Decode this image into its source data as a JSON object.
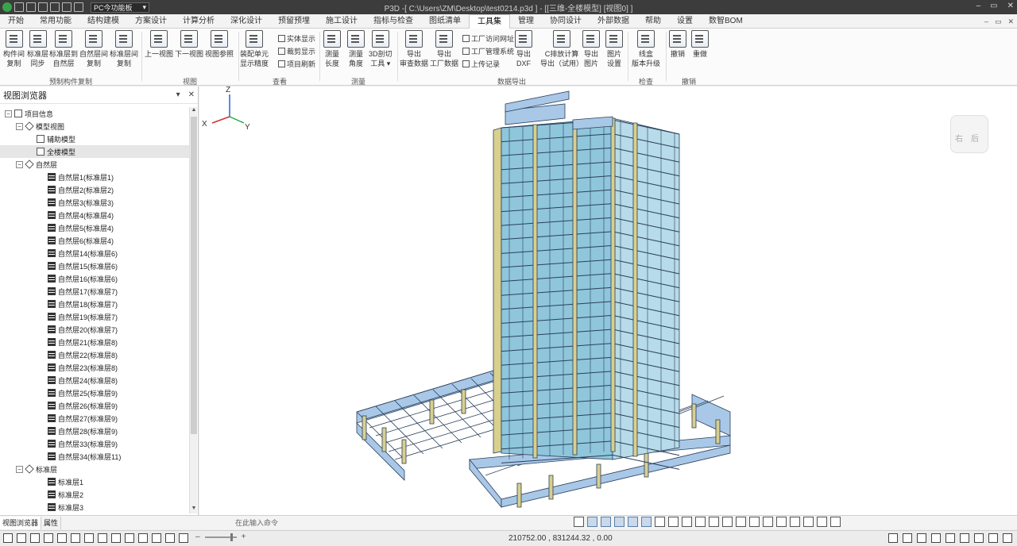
{
  "titlebar": {
    "mode": "PC今功能板",
    "title": "P3D -[ C:\\Users\\ZM\\Desktop\\test0214.p3d ] - [[三维-全楼模型]  [视图0] ]",
    "controls": [
      "–",
      "▭",
      "✕"
    ]
  },
  "menu": {
    "items": [
      "开始",
      "常用功能",
      "结构建模",
      "方案设计",
      "计算分析",
      "深化设计",
      "预留预埋",
      "施工设计",
      "指标与检查",
      "图纸清单",
      "工具集",
      "管理",
      "协同设计",
      "外部数据",
      "帮助",
      "设置",
      "数智BOM"
    ],
    "active_index": 10,
    "right_controls": [
      "–",
      "▭",
      "✕"
    ]
  },
  "ribbon": {
    "buttons": [
      {
        "line1": "构件间",
        "line2": "复制"
      },
      {
        "line1": "标准层",
        "line2": "同步"
      },
      {
        "line1": "标准层到",
        "line2": "自然层"
      },
      {
        "line1": "自然层间",
        "line2": "复制"
      },
      {
        "line1": "标准层间",
        "line2": "复制"
      },
      {
        "line1": "上一视图",
        "line2": ""
      },
      {
        "line1": "下一视图",
        "line2": ""
      },
      {
        "line1": "视图参照",
        "line2": ""
      },
      {
        "line1": "装配单元",
        "line2": "显示精度"
      },
      {
        "line1": "测量",
        "line2": "长度"
      },
      {
        "line1": "测量",
        "line2": "角度"
      },
      {
        "line1": "3D剖切",
        "line2": "工具 ▾"
      },
      {
        "line1": "导出",
        "line2": "审查数据"
      },
      {
        "line1": "导出",
        "line2": "工厂数据"
      },
      {
        "line1": "导出",
        "line2": "DXF"
      },
      {
        "line1": "C排放计算",
        "line2": "导出（试用）"
      },
      {
        "line1": "导出",
        "line2": "图片"
      },
      {
        "line1": "图片",
        "line2": "设置"
      },
      {
        "line1": "线盒",
        "line2": "版本升级"
      },
      {
        "line1": "撤销",
        "line2": ""
      },
      {
        "line1": "重做",
        "line2": ""
      }
    ],
    "small_view": [
      "实体显示",
      "裁剪显示",
      "项目刷新"
    ],
    "small_data": [
      "工厂访问网址",
      "工厂管理系统",
      "上传记录"
    ],
    "groups": [
      "预制构件复制",
      "视图",
      "查看",
      "测量",
      "数据导出",
      "检查",
      "撤销"
    ]
  },
  "panel": {
    "title": "视图浏览器",
    "controls": [
      "▾",
      "✕"
    ],
    "tree": [
      {
        "level": 0,
        "exp": "⊟",
        "icon": "doc",
        "label": "项目信息"
      },
      {
        "level": 1,
        "exp": "⊟",
        "icon": "cube",
        "label": "模型视图"
      },
      {
        "level": 2,
        "exp": "",
        "icon": "doc",
        "label": "辅助模型"
      },
      {
        "level": 2,
        "exp": "",
        "icon": "doc",
        "label": "全楼模型",
        "selected": true
      },
      {
        "level": 1,
        "exp": "⊟",
        "icon": "cube",
        "label": "自然层"
      },
      {
        "level": 3,
        "exp": "",
        "icon": "layer",
        "label": "自然层1(标准层1)"
      },
      {
        "level": 3,
        "exp": "",
        "icon": "layer",
        "label": "自然层2(标准层2)"
      },
      {
        "level": 3,
        "exp": "",
        "icon": "layer",
        "label": "自然层3(标准层3)"
      },
      {
        "level": 3,
        "exp": "",
        "icon": "layer",
        "label": "自然层4(标准层4)"
      },
      {
        "level": 3,
        "exp": "",
        "icon": "layer",
        "label": "自然层5(标准层4)"
      },
      {
        "level": 3,
        "exp": "",
        "icon": "layer",
        "label": "自然层6(标准层4)"
      },
      {
        "level": 3,
        "exp": "",
        "icon": "layer",
        "label": "自然层14(标准层6)"
      },
      {
        "level": 3,
        "exp": "",
        "icon": "layer",
        "label": "自然层15(标准层6)"
      },
      {
        "level": 3,
        "exp": "",
        "icon": "layer",
        "label": "自然层16(标准层6)"
      },
      {
        "level": 3,
        "exp": "",
        "icon": "layer",
        "label": "自然层17(标准层7)"
      },
      {
        "level": 3,
        "exp": "",
        "icon": "layer",
        "label": "自然层18(标准层7)"
      },
      {
        "level": 3,
        "exp": "",
        "icon": "layer",
        "label": "自然层19(标准层7)"
      },
      {
        "level": 3,
        "exp": "",
        "icon": "layer",
        "label": "自然层20(标准层7)"
      },
      {
        "level": 3,
        "exp": "",
        "icon": "layer",
        "label": "自然层21(标准层8)"
      },
      {
        "level": 3,
        "exp": "",
        "icon": "layer",
        "label": "自然层22(标准层8)"
      },
      {
        "level": 3,
        "exp": "",
        "icon": "layer",
        "label": "自然层23(标准层8)"
      },
      {
        "level": 3,
        "exp": "",
        "icon": "layer",
        "label": "自然层24(标准层8)"
      },
      {
        "level": 3,
        "exp": "",
        "icon": "layer",
        "label": "自然层25(标准层9)"
      },
      {
        "level": 3,
        "exp": "",
        "icon": "layer",
        "label": "自然层26(标准层9)"
      },
      {
        "level": 3,
        "exp": "",
        "icon": "layer",
        "label": "自然层27(标准层9)"
      },
      {
        "level": 3,
        "exp": "",
        "icon": "layer",
        "label": "自然层28(标准层9)"
      },
      {
        "level": 3,
        "exp": "",
        "icon": "layer",
        "label": "自然层33(标准层9)"
      },
      {
        "level": 3,
        "exp": "",
        "icon": "layer",
        "label": "自然层34(标准层11)"
      },
      {
        "level": 1,
        "exp": "⊟",
        "icon": "cube",
        "label": "标准层"
      },
      {
        "level": 3,
        "exp": "",
        "icon": "layer",
        "label": "标准层1"
      },
      {
        "level": 3,
        "exp": "",
        "icon": "layer",
        "label": "标准层2"
      },
      {
        "level": 3,
        "exp": "",
        "icon": "layer",
        "label": "标准层3"
      }
    ]
  },
  "viewport": {
    "axes": {
      "z": "Z",
      "x": "X",
      "y": "Y"
    },
    "navcube": {
      "front": "右",
      "right": "后"
    }
  },
  "bottom": {
    "tabs": [
      "视图浏览器",
      "属性"
    ],
    "command_placeholder": "在此输入命令"
  },
  "status": {
    "zoom_minus": "–",
    "zoom_plus": "+",
    "coords": "210752.00 , 831244.32 , 0.00"
  },
  "colors": {
    "beam": "#8fc6db",
    "column": "#d9cf8e",
    "line": "#2a3f5a",
    "foundation": "#a9c8e8"
  }
}
